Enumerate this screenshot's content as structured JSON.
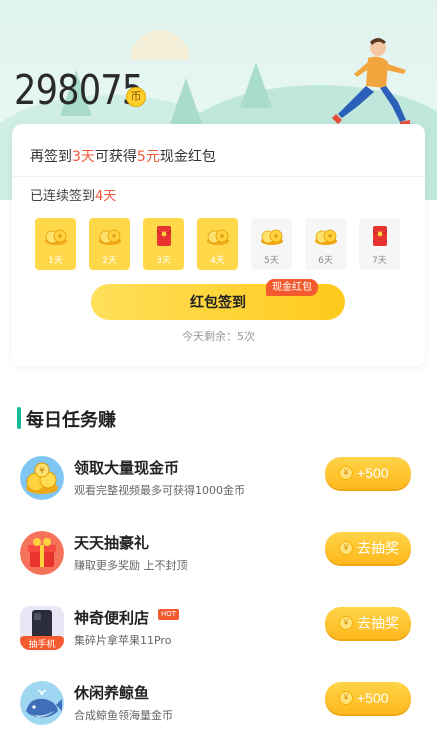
{
  "header": {
    "coin_balance": "298075",
    "coin_unit": "币"
  },
  "signin": {
    "prompt_prefix": "再签到",
    "prompt_days": "3天",
    "prompt_mid": "可获得",
    "prompt_amount": "5元",
    "prompt_suffix": "现金红包",
    "streak_prefix": "已连续签到",
    "streak_days": "4天",
    "days": [
      {
        "label": "1天",
        "state": "done",
        "reward": "coin"
      },
      {
        "label": "2天",
        "state": "done",
        "reward": "coin"
      },
      {
        "label": "3天",
        "state": "done",
        "reward": "red-envelope"
      },
      {
        "label": "4天",
        "state": "done",
        "reward": "coin"
      },
      {
        "label": "5天",
        "state": "todo",
        "reward": "coin"
      },
      {
        "label": "6天",
        "state": "todo",
        "reward": "coin"
      },
      {
        "label": "7天",
        "state": "todo",
        "reward": "red-envelope"
      }
    ],
    "button_label": "红包签到",
    "button_tag": "现金红包",
    "remaining": "今天剩余：5次"
  },
  "tasks_section": {
    "title": "每日任务赚",
    "items": [
      {
        "title": "领取大量现金币",
        "desc": "观看完整视频最多可获得1000金币",
        "action": "+500",
        "icon": "coin-pile-icon"
      },
      {
        "title": "天天抽豪礼",
        "desc": "赚取更多奖励 上不封顶",
        "action": "去抽奖",
        "icon": "gift-box-icon"
      },
      {
        "title": "神奇便利店",
        "desc": "集碎片拿苹果11Pro",
        "action": "去抽奖",
        "icon": "phone-icon",
        "badge": "HOT",
        "icon_label": "抽手机"
      },
      {
        "title": "休闲养鲸鱼",
        "desc": "合成鲸鱼领海量金币",
        "action": "+500",
        "icon": "whale-icon"
      }
    ]
  },
  "colors": {
    "accent_red": "#f0573a",
    "accent_yellow": "#ffc91c",
    "section_green": "#18b99a"
  }
}
